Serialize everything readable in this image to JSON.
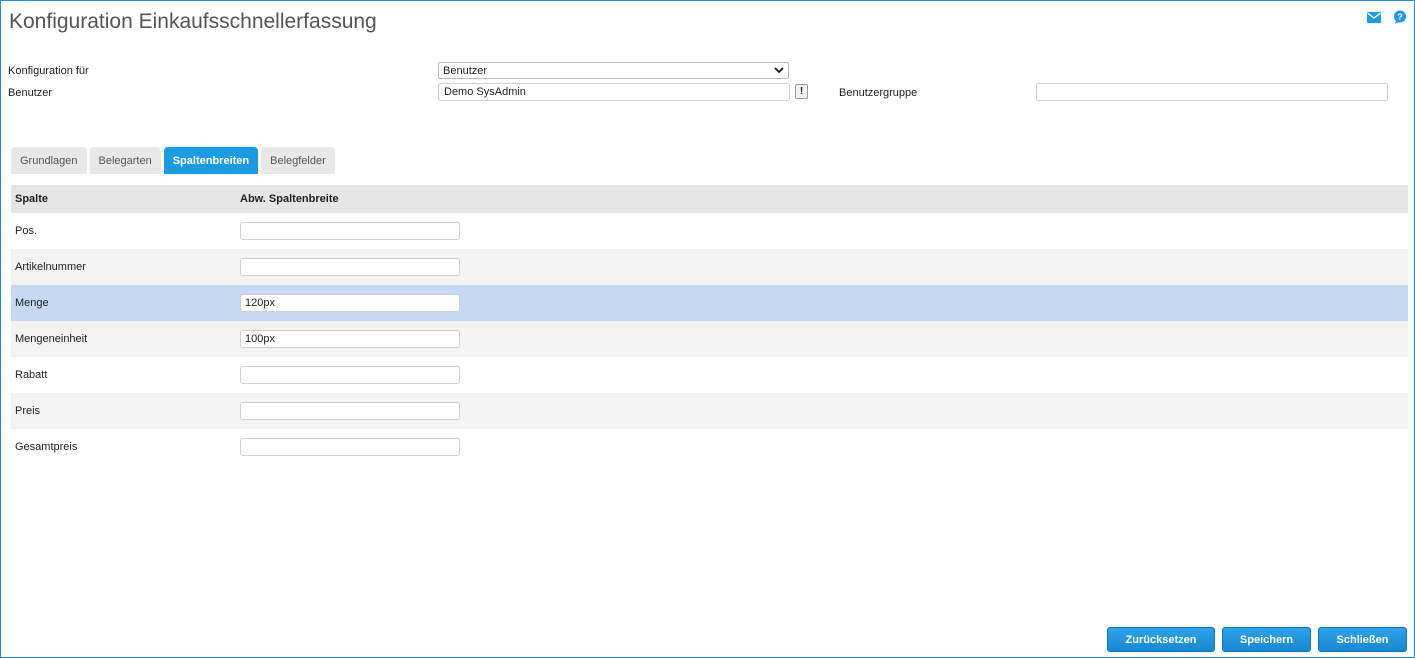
{
  "page": {
    "title": "Konfiguration Einkaufsschnellerfassung"
  },
  "top_icons": [
    {
      "icon": "mail-icon",
      "color": "#1a9be2"
    },
    {
      "icon": "help-chat-icon",
      "color": "#1a9be2"
    }
  ],
  "form": {
    "konfiguration_label": "Konfiguration für",
    "konfiguration_value": "Benutzer",
    "benutzer_label": "Benutzer",
    "benutzer_value": "Demo SysAdmin",
    "benutzer_button": "!",
    "benutzergruppe_label": "Benutzergruppe",
    "benutzergruppe_value": ""
  },
  "tabs": [
    {
      "label": "Grundlagen",
      "active": false
    },
    {
      "label": "Belegarten",
      "active": false
    },
    {
      "label": "Spaltenbreiten",
      "active": true
    },
    {
      "label": "Belegfelder",
      "active": false
    }
  ],
  "grid": {
    "headers": [
      "Spalte",
      "Abw. Spaltenbreite"
    ],
    "rows": [
      {
        "name": "Pos.",
        "value": ""
      },
      {
        "name": "Artikelnummer",
        "value": ""
      },
      {
        "name": "Menge",
        "value": "120px",
        "selected": true
      },
      {
        "name": "Mengeneinheit",
        "value": "100px"
      },
      {
        "name": "Rabatt",
        "value": ""
      },
      {
        "name": "Preis",
        "value": ""
      },
      {
        "name": "Gesamtpreis",
        "value": ""
      }
    ]
  },
  "buttons": {
    "reset": "Zurücksetzen",
    "save": "Speichern",
    "close": "Schließen"
  },
  "colors": {
    "accent": "#1a9be2",
    "selected_row": "#c5d9f5"
  }
}
